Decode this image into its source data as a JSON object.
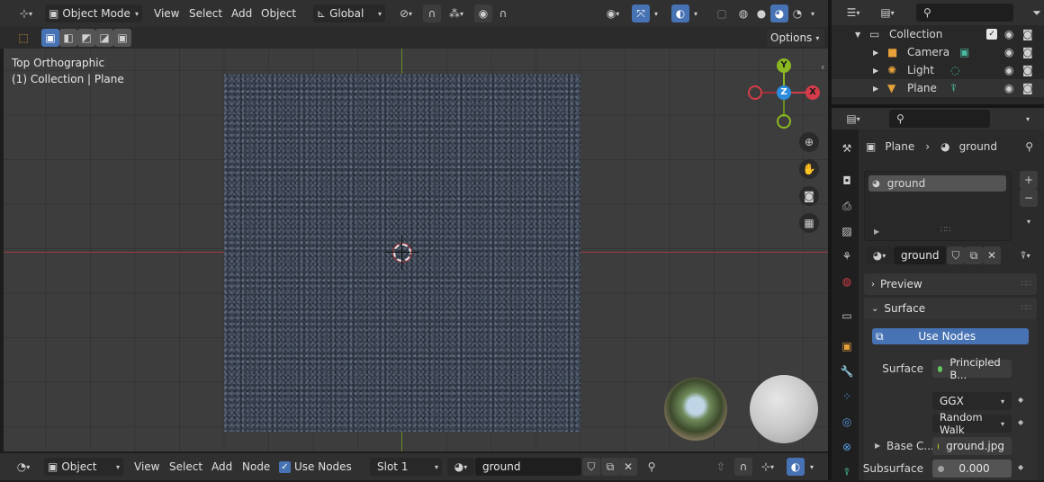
{
  "top_header": {
    "mode": "Object Mode",
    "menus": [
      "View",
      "Select",
      "Add",
      "Object"
    ],
    "orientation": "Global",
    "options_label": "Options"
  },
  "viewport": {
    "view_name": "Top Orthographic",
    "context": "(1) Collection | Plane",
    "gizmo": {
      "y": "Y",
      "z": "Z",
      "x": "X"
    }
  },
  "bottom_header": {
    "object_label": "Object",
    "menus": [
      "View",
      "Select",
      "Add",
      "Node"
    ],
    "use_nodes_label": "Use Nodes",
    "slot": "Slot 1",
    "material": "ground"
  },
  "outliner": {
    "collection": "Collection",
    "items": [
      "Camera",
      "Light",
      "Plane"
    ]
  },
  "properties": {
    "breadcrumb_object": "Plane",
    "breadcrumb_material": "ground",
    "slot_material": "ground",
    "material_name": "ground",
    "preview_label": "Preview",
    "surface_panel": "Surface",
    "use_nodes_button": "Use Nodes",
    "surface_label": "Surface",
    "surface_value": "Principled B...",
    "distribution": "GGX",
    "subsurface_method": "Random Walk",
    "base_color_label": "Base C...",
    "base_color_value": "ground.jpg",
    "subsurface_label": "Subsurface",
    "subsurface_value": "0.000"
  },
  "colors": {
    "accent_blue": "#4772b3",
    "gizmo_x": "#d43c49",
    "gizmo_y": "#8bb822",
    "gizmo_z": "#2c8ce0"
  }
}
